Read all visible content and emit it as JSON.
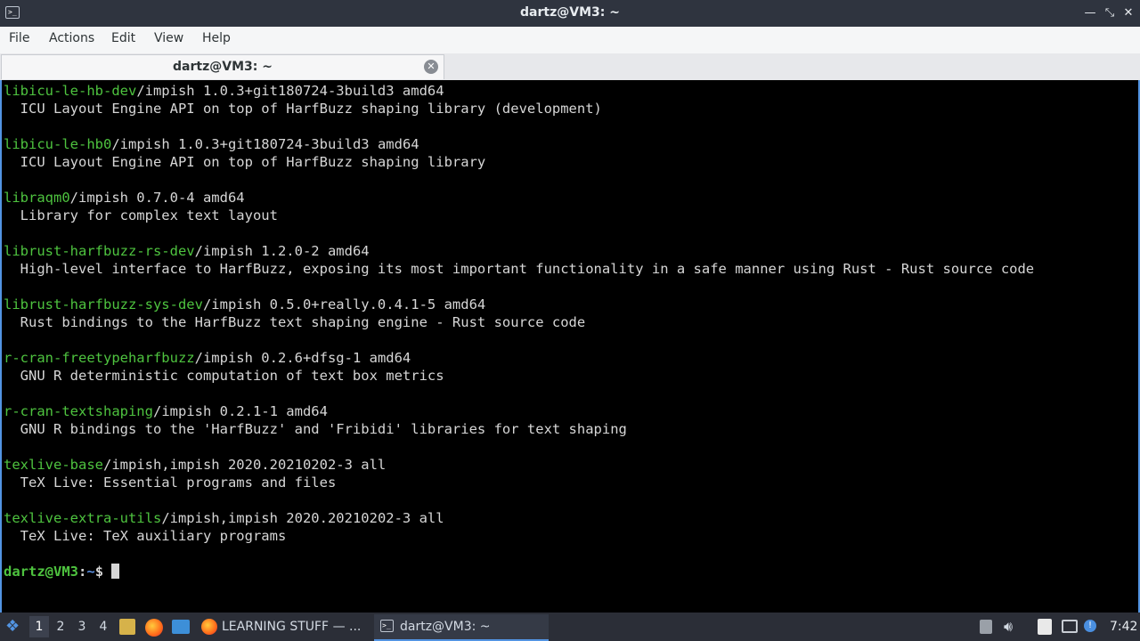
{
  "window": {
    "title": "dartz@VM3: ~"
  },
  "menubar": {
    "items": [
      "File",
      "Actions",
      "Edit",
      "View",
      "Help"
    ]
  },
  "tab": {
    "label": "dartz@VM3: ~"
  },
  "terminal": {
    "entries": [
      {
        "pkg": "libicu-le-hb-dev",
        "rest": "/impish 1.0.3+git180724-3build3 amd64",
        "desc": "  ICU Layout Engine API on top of HarfBuzz shaping library (development)"
      },
      {
        "pkg": "libicu-le-hb0",
        "rest": "/impish 1.0.3+git180724-3build3 amd64",
        "desc": "  ICU Layout Engine API on top of HarfBuzz shaping library"
      },
      {
        "pkg": "libraqm0",
        "rest": "/impish 0.7.0-4 amd64",
        "desc": "  Library for complex text layout"
      },
      {
        "pkg": "librust-harfbuzz-rs-dev",
        "rest": "/impish 1.2.0-2 amd64",
        "desc": "  High-level interface to HarfBuzz, exposing its most important functionality in a safe manner using Rust - Rust source code"
      },
      {
        "pkg": "librust-harfbuzz-sys-dev",
        "rest": "/impish 0.5.0+really.0.4.1-5 amd64",
        "desc": "  Rust bindings to the HarfBuzz text shaping engine - Rust source code"
      },
      {
        "pkg": "r-cran-freetypeharfbuzz",
        "rest": "/impish 0.2.6+dfsg-1 amd64",
        "desc": "  GNU R deterministic computation of text box metrics"
      },
      {
        "pkg": "r-cran-textshaping",
        "rest": "/impish 0.2.1-1 amd64",
        "desc": "  GNU R bindings to the 'HarfBuzz' and 'Fribidi' libraries for text shaping"
      },
      {
        "pkg": "texlive-base",
        "rest": "/impish,impish 2020.20210202-3 all",
        "desc": "  TeX Live: Essential programs and files"
      },
      {
        "pkg": "texlive-extra-utils",
        "rest": "/impish,impish 2020.20210202-3 all",
        "desc": "  TeX Live: TeX auxiliary programs"
      }
    ],
    "prompt": {
      "user": "dartz@VM3",
      "sep": ":",
      "path": "~",
      "symbol": "$ "
    }
  },
  "taskbar": {
    "workspaces": [
      "1",
      "2",
      "3",
      "4"
    ],
    "active_workspace": "1",
    "tasks": [
      {
        "label": "LEARNING STUFF — ...",
        "icon": "firefox-icon"
      },
      {
        "label": "dartz@VM3: ~",
        "icon": "terminal-icon"
      }
    ],
    "clock": "7:42"
  },
  "colors": {
    "accent": "#5294e2",
    "package_green": "#4ec33f",
    "prompt_path_blue": "#5b8fe0",
    "titlebar": "#2f343f",
    "taskbar": "#2b2e37"
  }
}
